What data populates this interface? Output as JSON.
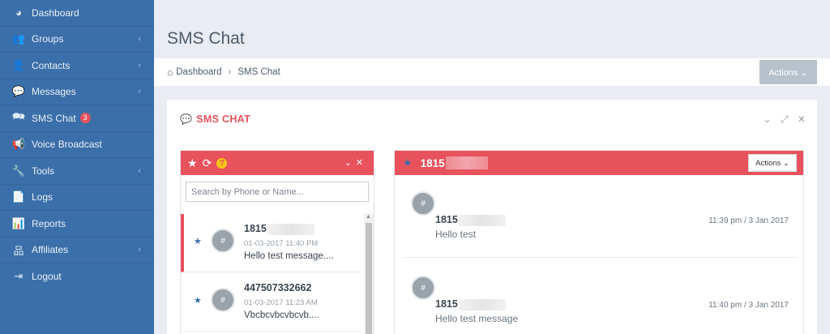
{
  "sidebar": {
    "items": [
      {
        "label": "Dashboard",
        "icon": "dashboard-icon",
        "glyph": "◕"
      },
      {
        "label": "Groups",
        "icon": "users-icon",
        "glyph": "👥"
      },
      {
        "label": "Contacts",
        "icon": "user-icon",
        "glyph": "👤"
      },
      {
        "label": "Messages",
        "icon": "speech-bubble-icon",
        "glyph": "💬"
      },
      {
        "label": "SMS Chat",
        "icon": "chat-bubbles-icon",
        "glyph": "🗪",
        "badge": "3"
      },
      {
        "label": "Voice Broadcast",
        "icon": "megaphone-icon",
        "glyph": "📢"
      },
      {
        "label": "Tools",
        "icon": "wrench-icon",
        "glyph": "🔧"
      },
      {
        "label": "Logs",
        "icon": "document-icon",
        "glyph": "📄"
      },
      {
        "label": "Reports",
        "icon": "bar-chart-icon",
        "glyph": "📊"
      },
      {
        "label": "Affiliates",
        "icon": "sitemap-icon",
        "glyph": "品"
      },
      {
        "label": "Logout",
        "icon": "sign-out-icon",
        "glyph": "⇥"
      }
    ]
  },
  "header": {
    "title": "SMS Chat",
    "breadcrumb": [
      "Dashboard",
      "SMS Chat"
    ],
    "actions_label": "Actions ⌄"
  },
  "panel": {
    "title": "SMS CHAT",
    "tools": "⌄ ⤢ ✕"
  },
  "chat_list": {
    "search_placeholder": "Search by Phone or Name...",
    "conversations": [
      {
        "phone": "1815",
        "date": "01-03-2017 11:40 PM",
        "preview": "Hello test message....",
        "avatar": "#"
      },
      {
        "phone": "447507332662",
        "date": "01-03-2017 11:23 AM",
        "preview": "Vbcbcvbcvbcvb....",
        "avatar": "#"
      }
    ]
  },
  "conversation": {
    "phone": "1815",
    "actions_label": "Actions ⌄",
    "messages": [
      {
        "sender": "1815",
        "text": "Hello test",
        "time": "11:39 pm / 3 Jan 2017",
        "avatar": "#"
      },
      {
        "sender": "1815",
        "text": "Hello test message",
        "time": "11:40 pm / 3 Jan 2017",
        "avatar": "#"
      }
    ]
  }
}
